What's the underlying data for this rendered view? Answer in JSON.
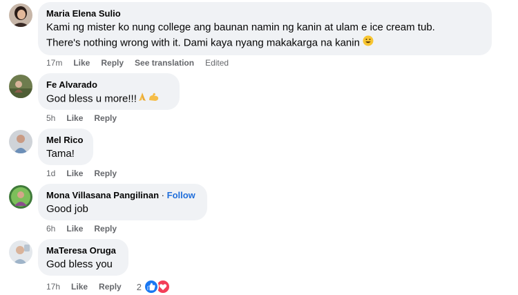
{
  "comments": [
    {
      "name": "Maria Elena Sulio",
      "line1": "Kami ng mister ko nung college ang baunan namin ng kanin at ulam e ice cream tub.",
      "line2": "There's nothing wrong with it. Dami kaya nyang makakarga na kanin",
      "time": "17m",
      "like": "Like",
      "reply": "Reply",
      "see_translation": "See translation",
      "edited": "Edited"
    },
    {
      "name": "Fe Alvarado",
      "text": "God bless u more!!!",
      "time": "5h",
      "like": "Like",
      "reply": "Reply"
    },
    {
      "name": "Mel Rico",
      "text": "Tama!",
      "time": "1d",
      "like": "Like",
      "reply": "Reply"
    },
    {
      "name": "Mona Villasana Pangilinan",
      "separator": "·",
      "follow": "Follow",
      "text": "Good job",
      "time": "6h",
      "like": "Like",
      "reply": "Reply"
    },
    {
      "name": "MaTeresa Oruga",
      "text": "God bless you",
      "time": "17h",
      "like": "Like",
      "reply": "Reply",
      "reaction_count": "2"
    }
  ],
  "colors": {
    "bubble": "#f0f2f5",
    "meta": "#65676b",
    "follow": "#216fdb",
    "like_reaction": "#1877f2",
    "love_reaction": "#f33e58"
  },
  "icons": {
    "smile": "smiling-face-emoji",
    "pray": "folded-hands-emoji",
    "flex": "flexed-biceps-emoji",
    "like": "thumbs-up-reaction-icon",
    "love": "heart-reaction-icon"
  }
}
